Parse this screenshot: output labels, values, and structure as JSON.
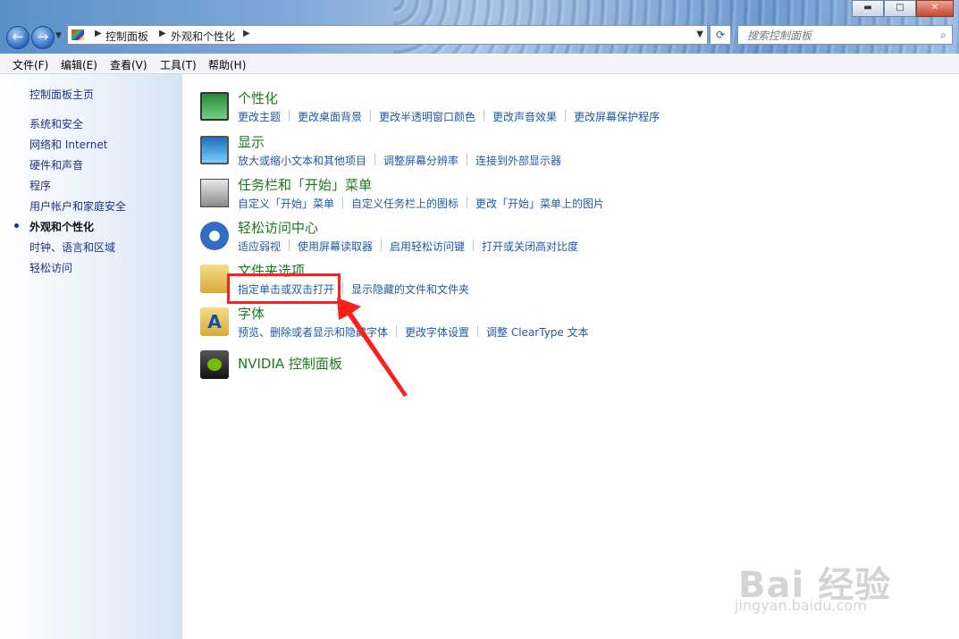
{
  "window": {
    "minimize": "▬",
    "maximize": "□",
    "close": "✕"
  },
  "nav": {
    "back": "←",
    "forward": "→"
  },
  "address": {
    "crumbs": [
      "控制面板",
      "外观和个性化"
    ]
  },
  "search": {
    "placeholder": "搜索控制面板"
  },
  "menu": [
    "文件(F)",
    "编辑(E)",
    "查看(V)",
    "工具(T)",
    "帮助(H)"
  ],
  "sidebar": {
    "home": "控制面板主页",
    "items": [
      {
        "label": "系统和安全"
      },
      {
        "label": "网络和 Internet"
      },
      {
        "label": "硬件和声音"
      },
      {
        "label": "程序"
      },
      {
        "label": "用户帐户和家庭安全"
      },
      {
        "label": "外观和个性化",
        "active": true
      },
      {
        "label": "时钟、语言和区域"
      },
      {
        "label": "轻松访问"
      }
    ]
  },
  "categories": [
    {
      "title": "个性化",
      "icon": "personalization-icon",
      "links": [
        "更改主题",
        "更改桌面背景",
        "更改半透明窗口颜色",
        "更改声音效果",
        "更改屏幕保护程序"
      ]
    },
    {
      "title": "显示",
      "icon": "display-icon",
      "links": [
        "放大或缩小文本和其他项目",
        "调整屏幕分辨率",
        "连接到外部显示器"
      ]
    },
    {
      "title": "任务栏和「开始」菜单",
      "icon": "taskbar-icon",
      "links": [
        "自定义「开始」菜单",
        "自定义任务栏上的图标",
        "更改「开始」菜单上的图片"
      ]
    },
    {
      "title": "轻松访问中心",
      "icon": "ease-of-access-icon",
      "links": [
        "适应弱视",
        "使用屏幕读取器",
        "启用轻松访问键",
        "打开或关闭高对比度"
      ]
    },
    {
      "title": "文件夹选项",
      "icon": "folder-options-icon",
      "links": [
        "指定单击或双击打开",
        "显示隐藏的文件和文件夹"
      ]
    },
    {
      "title": "字体",
      "icon": "fonts-icon",
      "links": [
        "预览、删除或者显示和隐藏字体",
        "更改字体设置",
        "调整 ClearType 文本"
      ]
    },
    {
      "title": "NVIDIA 控制面板",
      "icon": "nvidia-icon",
      "links": []
    }
  ],
  "watermark": {
    "text": "Bai 经验",
    "sub": "jingyan.baidu.com"
  },
  "colors": {
    "link": "#1d5aa8",
    "category_title": "#1a7a1a",
    "sidebar_link": "#1e3287",
    "highlight": "#ff1e1e"
  }
}
